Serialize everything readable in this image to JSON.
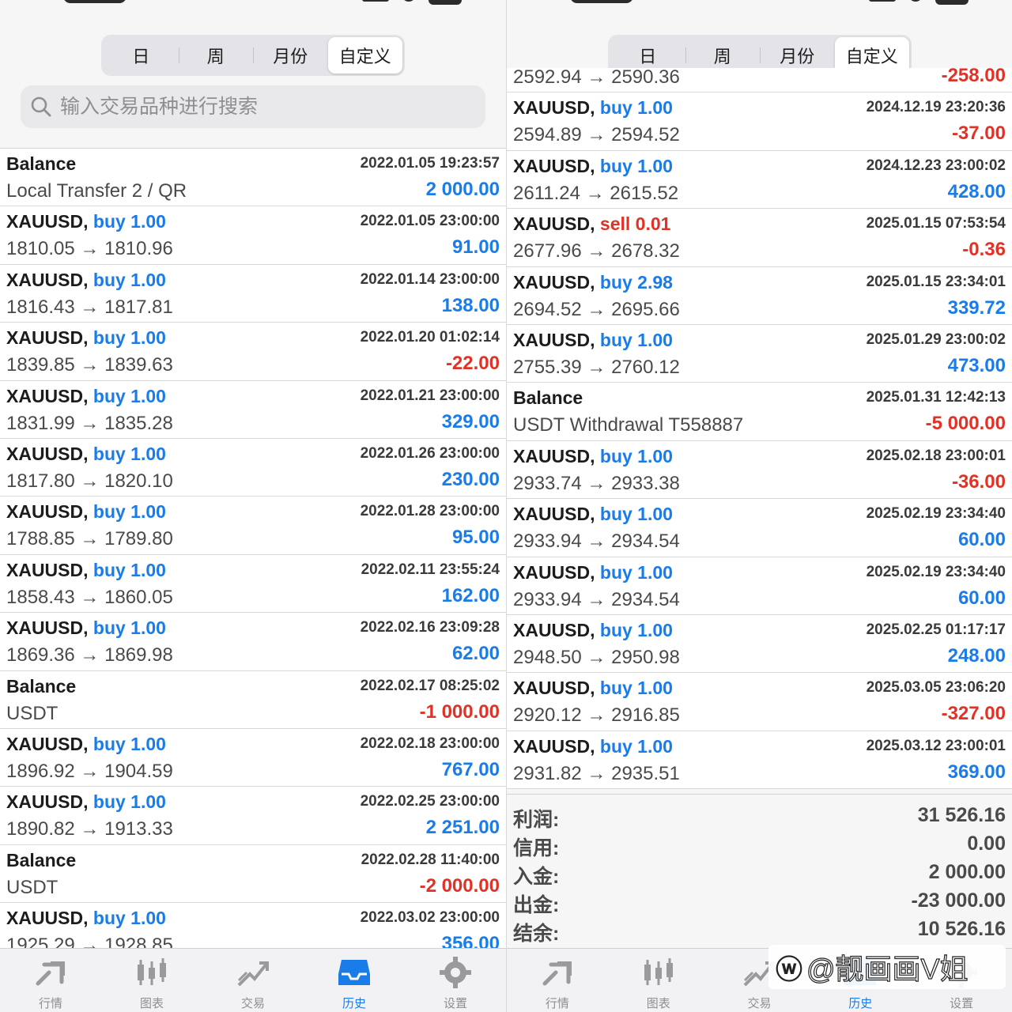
{
  "segments": [
    "日",
    "周",
    "月份",
    "自定义"
  ],
  "search_placeholder": "输入交易品种进行搜索",
  "left_rows": [
    {
      "title": "Balance",
      "side": "",
      "side_class": "",
      "date": "2022.01.05 19:23:57",
      "sub": "Local Transfer 2 / QR",
      "amount": "2 000.00",
      "amount_class": "pos"
    },
    {
      "title": "XAUUSD, ",
      "side": "buy 1.00",
      "side_class": "buy",
      "date": "2022.01.05 23:00:00",
      "sub": "1810.05 → 1810.96",
      "amount": "91.00",
      "amount_class": "pos"
    },
    {
      "title": "XAUUSD, ",
      "side": "buy 1.00",
      "side_class": "buy",
      "date": "2022.01.14 23:00:00",
      "sub": "1816.43 → 1817.81",
      "amount": "138.00",
      "amount_class": "pos"
    },
    {
      "title": "XAUUSD, ",
      "side": "buy 1.00",
      "side_class": "buy",
      "date": "2022.01.20 01:02:14",
      "sub": "1839.85 → 1839.63",
      "amount": "-22.00",
      "amount_class": "neg"
    },
    {
      "title": "XAUUSD, ",
      "side": "buy 1.00",
      "side_class": "buy",
      "date": "2022.01.21 23:00:00",
      "sub": "1831.99 → 1835.28",
      "amount": "329.00",
      "amount_class": "pos"
    },
    {
      "title": "XAUUSD, ",
      "side": "buy 1.00",
      "side_class": "buy",
      "date": "2022.01.26 23:00:00",
      "sub": "1817.80 → 1820.10",
      "amount": "230.00",
      "amount_class": "pos"
    },
    {
      "title": "XAUUSD, ",
      "side": "buy 1.00",
      "side_class": "buy",
      "date": "2022.01.28 23:00:00",
      "sub": "1788.85 → 1789.80",
      "amount": "95.00",
      "amount_class": "pos"
    },
    {
      "title": "XAUUSD, ",
      "side": "buy 1.00",
      "side_class": "buy",
      "date": "2022.02.11 23:55:24",
      "sub": "1858.43 → 1860.05",
      "amount": "162.00",
      "amount_class": "pos"
    },
    {
      "title": "XAUUSD, ",
      "side": "buy 1.00",
      "side_class": "buy",
      "date": "2022.02.16 23:09:28",
      "sub": "1869.36 → 1869.98",
      "amount": "62.00",
      "amount_class": "pos"
    },
    {
      "title": "Balance",
      "side": "",
      "side_class": "",
      "date": "2022.02.17 08:25:02",
      "sub": "USDT",
      "amount": "-1 000.00",
      "amount_class": "neg"
    },
    {
      "title": "XAUUSD, ",
      "side": "buy 1.00",
      "side_class": "buy",
      "date": "2022.02.18 23:00:00",
      "sub": "1896.92 → 1904.59",
      "amount": "767.00",
      "amount_class": "pos"
    },
    {
      "title": "XAUUSD, ",
      "side": "buy 1.00",
      "side_class": "buy",
      "date": "2022.02.25 23:00:00",
      "sub": "1890.82 → 1913.33",
      "amount": "2 251.00",
      "amount_class": "pos"
    },
    {
      "title": "Balance",
      "side": "",
      "side_class": "",
      "date": "2022.02.28 11:40:00",
      "sub": "USDT",
      "amount": "-2 000.00",
      "amount_class": "neg"
    },
    {
      "title": "XAUUSD, ",
      "side": "buy 1.00",
      "side_class": "buy",
      "date": "2022.03.02 23:00:00",
      "sub": "1925.29 → 1928.85",
      "amount": "356.00",
      "amount_class": "pos"
    }
  ],
  "right_rows": [
    {
      "title": "",
      "side": "",
      "side_class": "",
      "date": "",
      "sub": "2592.94 → 2590.36",
      "amount": "-258.00",
      "amount_class": "neg"
    },
    {
      "title": "XAUUSD, ",
      "side": "buy 1.00",
      "side_class": "buy",
      "date": "2024.12.19 23:20:36",
      "sub": "2594.89 → 2594.52",
      "amount": "-37.00",
      "amount_class": "neg"
    },
    {
      "title": "XAUUSD, ",
      "side": "buy 1.00",
      "side_class": "buy",
      "date": "2024.12.23 23:00:02",
      "sub": "2611.24 → 2615.52",
      "amount": "428.00",
      "amount_class": "pos"
    },
    {
      "title": "XAUUSD, ",
      "side": "sell 0.01",
      "side_class": "sell",
      "date": "2025.01.15 07:53:54",
      "sub": "2677.96 → 2678.32",
      "amount": "-0.36",
      "amount_class": "neg"
    },
    {
      "title": "XAUUSD, ",
      "side": "buy 2.98",
      "side_class": "buy",
      "date": "2025.01.15 23:34:01",
      "sub": "2694.52 → 2695.66",
      "amount": "339.72",
      "amount_class": "pos"
    },
    {
      "title": "XAUUSD, ",
      "side": "buy 1.00",
      "side_class": "buy",
      "date": "2025.01.29 23:00:02",
      "sub": "2755.39 → 2760.12",
      "amount": "473.00",
      "amount_class": "pos"
    },
    {
      "title": "Balance",
      "side": "",
      "side_class": "",
      "date": "2025.01.31 12:42:13",
      "sub": "USDT Withdrawal T558887",
      "amount": "-5 000.00",
      "amount_class": "neg"
    },
    {
      "title": "XAUUSD, ",
      "side": "buy 1.00",
      "side_class": "buy",
      "date": "2025.02.18 23:00:01",
      "sub": "2933.74 → 2933.38",
      "amount": "-36.00",
      "amount_class": "neg"
    },
    {
      "title": "XAUUSD, ",
      "side": "buy 1.00",
      "side_class": "buy",
      "date": "2025.02.19 23:34:40",
      "sub": "2933.94 → 2934.54",
      "amount": "60.00",
      "amount_class": "pos"
    },
    {
      "title": "XAUUSD, ",
      "side": "buy 1.00",
      "side_class": "buy",
      "date": "2025.02.19 23:34:40",
      "sub": "2933.94 → 2934.54",
      "amount": "60.00",
      "amount_class": "pos"
    },
    {
      "title": "XAUUSD, ",
      "side": "buy 1.00",
      "side_class": "buy",
      "date": "2025.02.25 01:17:17",
      "sub": "2948.50 → 2950.98",
      "amount": "248.00",
      "amount_class": "pos"
    },
    {
      "title": "XAUUSD, ",
      "side": "buy 1.00",
      "side_class": "buy",
      "date": "2025.03.05 23:06:20",
      "sub": "2920.12 → 2916.85",
      "amount": "-327.00",
      "amount_class": "neg"
    },
    {
      "title": "XAUUSD, ",
      "side": "buy 1.00",
      "side_class": "buy",
      "date": "2025.03.12 23:00:01",
      "sub": "2931.82 → 2935.51",
      "amount": "369.00",
      "amount_class": "pos"
    }
  ],
  "summary": [
    {
      "label": "利润:",
      "value": "31 526.16"
    },
    {
      "label": "信用:",
      "value": "0.00"
    },
    {
      "label": "入金:",
      "value": "2 000.00"
    },
    {
      "label": "出金:",
      "value": "-23 000.00"
    },
    {
      "label": "结余:",
      "value": "10 526.16"
    }
  ],
  "tabs": [
    {
      "label": "行情",
      "icon": "quotes-icon"
    },
    {
      "label": "图表",
      "icon": "chart-icon"
    },
    {
      "label": "交易",
      "icon": "trade-icon"
    },
    {
      "label": "历史",
      "icon": "history-icon"
    },
    {
      "label": "设置",
      "icon": "settings-icon"
    }
  ],
  "active_tab": "历史",
  "watermark": "@靓画画V姐",
  "colors": {
    "buy": "#1a7ce8",
    "sell": "#e03226",
    "tab_active": "#1a7ce8",
    "tab_inactive": "#8e8e93"
  }
}
